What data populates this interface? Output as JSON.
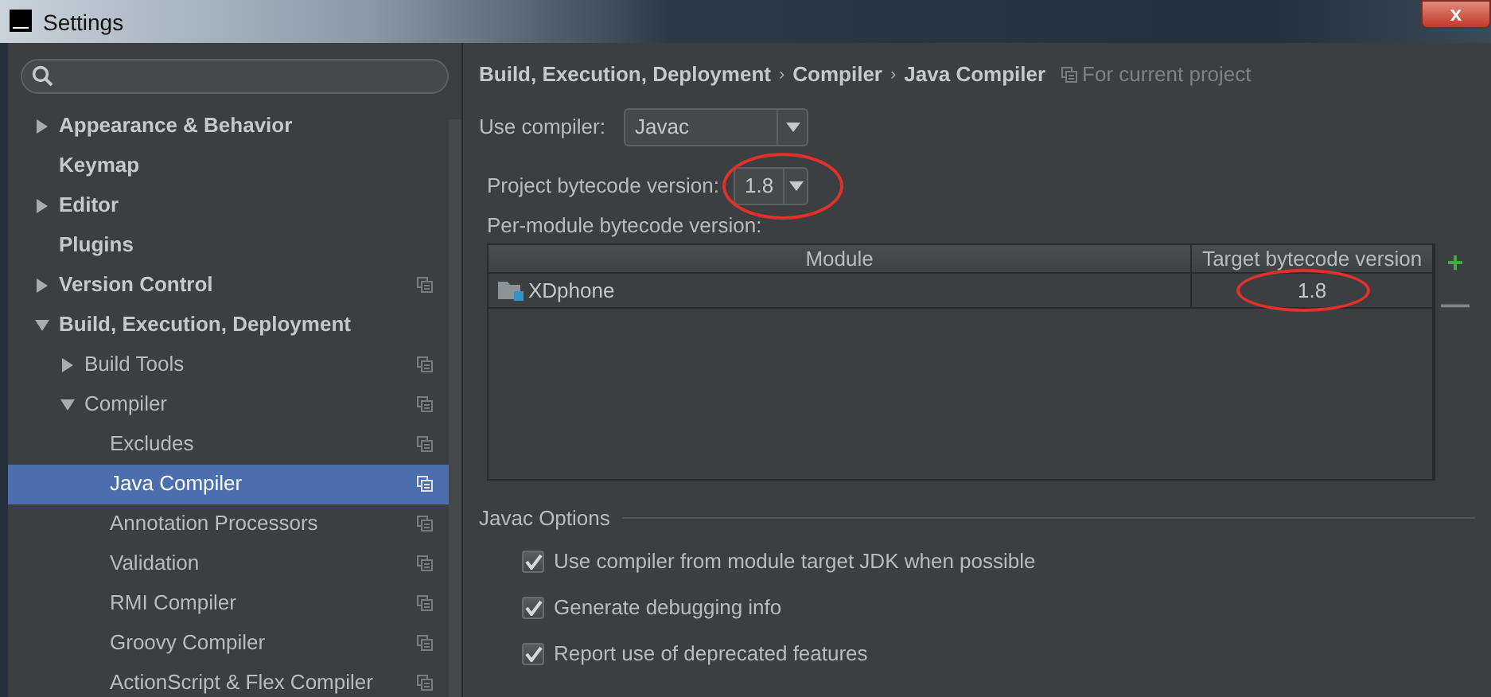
{
  "window": {
    "title": "Settings",
    "close": "x"
  },
  "tree": [
    {
      "label": "Appearance & Behavior",
      "bold": true,
      "expanded": false
    },
    {
      "label": "Keymap",
      "bold": true
    },
    {
      "label": "Editor",
      "bold": true,
      "expanded": false
    },
    {
      "label": "Plugins",
      "bold": true
    },
    {
      "label": "Version Control",
      "bold": true,
      "expanded": false,
      "project_scope": true
    },
    {
      "label": "Build, Execution, Deployment",
      "bold": true,
      "expanded": true,
      "children": [
        {
          "label": "Build Tools",
          "expanded": false,
          "project_scope": true
        },
        {
          "label": "Compiler",
          "expanded": true,
          "project_scope": true,
          "children": [
            {
              "label": "Excludes",
              "project_scope": true,
              "selected": false
            },
            {
              "label": "Java Compiler",
              "project_scope": true,
              "selected": true
            },
            {
              "label": "Annotation Processors",
              "project_scope": true,
              "selected": false
            },
            {
              "label": "Validation",
              "project_scope": true,
              "selected": false
            },
            {
              "label": "RMI Compiler",
              "project_scope": true,
              "selected": false
            },
            {
              "label": "Groovy Compiler",
              "project_scope": true,
              "selected": false
            },
            {
              "label": "ActionScript & Flex Compiler",
              "project_scope": true,
              "selected": false
            }
          ]
        }
      ]
    }
  ],
  "breadcrumb": {
    "items": [
      "Build, Execution, Deployment",
      "Compiler",
      "Java Compiler"
    ],
    "separator": "›",
    "scope": "For current project"
  },
  "use_compiler": {
    "label": "Use compiler:",
    "value": "Javac",
    "circled": false
  },
  "project_bytecode": {
    "label": "Project bytecode version:",
    "value": "1.8",
    "circled": true
  },
  "per_module": {
    "label": "Per-module bytecode version:",
    "columns": [
      "Module",
      "Target bytecode version"
    ],
    "rows": [
      {
        "module": "XDphone",
        "target": "1.8",
        "circled": true
      }
    ],
    "add": {
      "label": "+",
      "disabled": false
    },
    "remove": {
      "label": "—",
      "disabled": true
    }
  },
  "javac_options": {
    "title": "Javac Options",
    "options": [
      {
        "label": "Use compiler from module target JDK when possible",
        "checked": true
      },
      {
        "label": "Generate debugging info",
        "checked": true
      },
      {
        "label": "Report use of deprecated features",
        "checked": true
      }
    ]
  }
}
